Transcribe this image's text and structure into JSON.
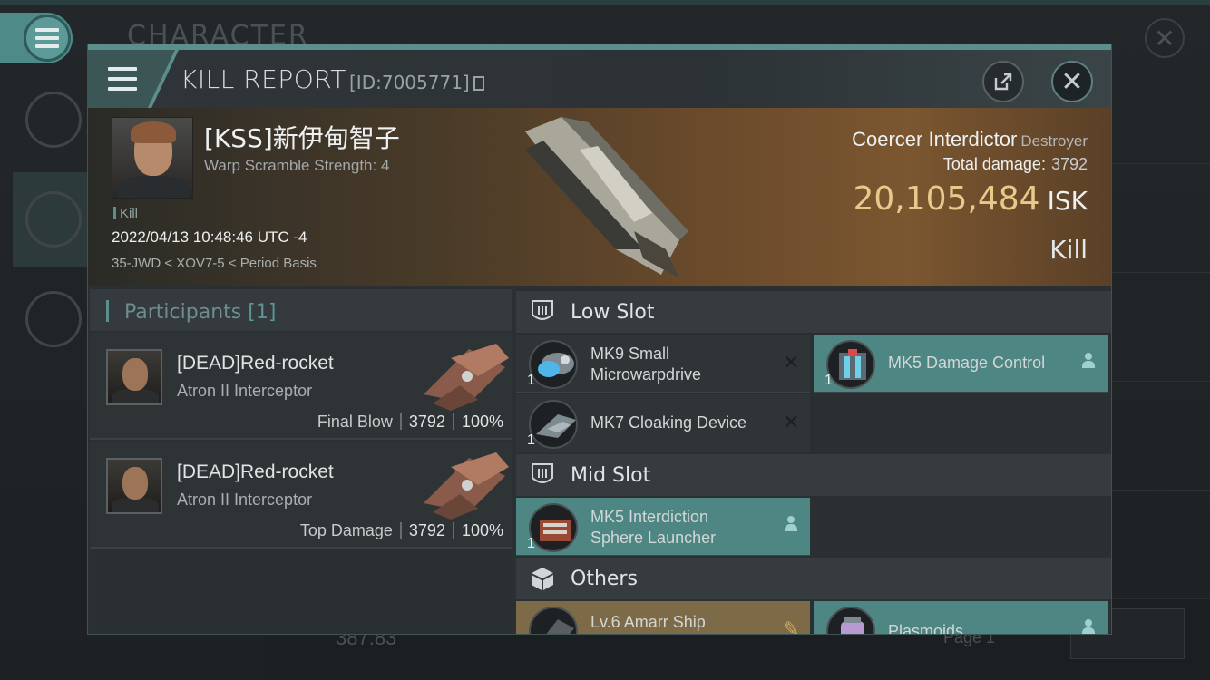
{
  "background": {
    "title": "CHARACTER",
    "bottom_value": "387.83",
    "page_label": "Page 1"
  },
  "header": {
    "title": "KILL REPORT",
    "id_label": "[ID:7005771]"
  },
  "victim": {
    "name": "[KSS]新伊甸智子",
    "subtitle": "Warp Scramble Strength: 4",
    "tag": "Kill",
    "datetime": "2022/04/13 10:48:46 UTC -4",
    "location": "35-JWD < XOV7-5 < Period Basis",
    "ship": "Coercer Interdictor",
    "ship_class": "Destroyer",
    "total_damage_label": "Total damage:",
    "total_damage": "3792",
    "isk_value": "20,105,484",
    "isk_unit": "ISK",
    "result": "Kill"
  },
  "participants": {
    "title": "Participants",
    "count": "[1]",
    "rows": [
      {
        "name": "[DEAD]Red-rocket",
        "ship": "Atron II Interceptor",
        "role": "Final Blow",
        "damage": "3792",
        "percent": "100%"
      },
      {
        "name": "[DEAD]Red-rocket",
        "ship": "Atron II Interceptor",
        "role": "Top Damage",
        "damage": "3792",
        "percent": "100%"
      }
    ]
  },
  "slots": {
    "low_title": "Low Slot",
    "mid_title": "Mid Slot",
    "others_title": "Others",
    "low": [
      {
        "qty": "1",
        "name_l1": "MK9 Small",
        "name_l2": "Microwarpdrive",
        "state": "destroyed"
      },
      {
        "qty": "1",
        "name_l1": "MK5 Damage Control",
        "name_l2": "",
        "state": "dropped"
      },
      {
        "qty": "1",
        "name_l1": "MK7 Cloaking Device",
        "name_l2": "",
        "state": "destroyed"
      }
    ],
    "mid": [
      {
        "qty": "1",
        "name_l1": "MK5 Interdiction",
        "name_l2": "Sphere Launcher",
        "state": "dropped"
      }
    ],
    "others": [
      {
        "name_l1": "Lv.6 Amarr Ship"
      },
      {
        "name_l1": "Plasmoids"
      }
    ]
  },
  "colors": {
    "accent": "#5b8e8c",
    "isk": "#e7c98a",
    "fitted_bg": "#4d8683",
    "cargo_bg": "#7d6a46"
  }
}
